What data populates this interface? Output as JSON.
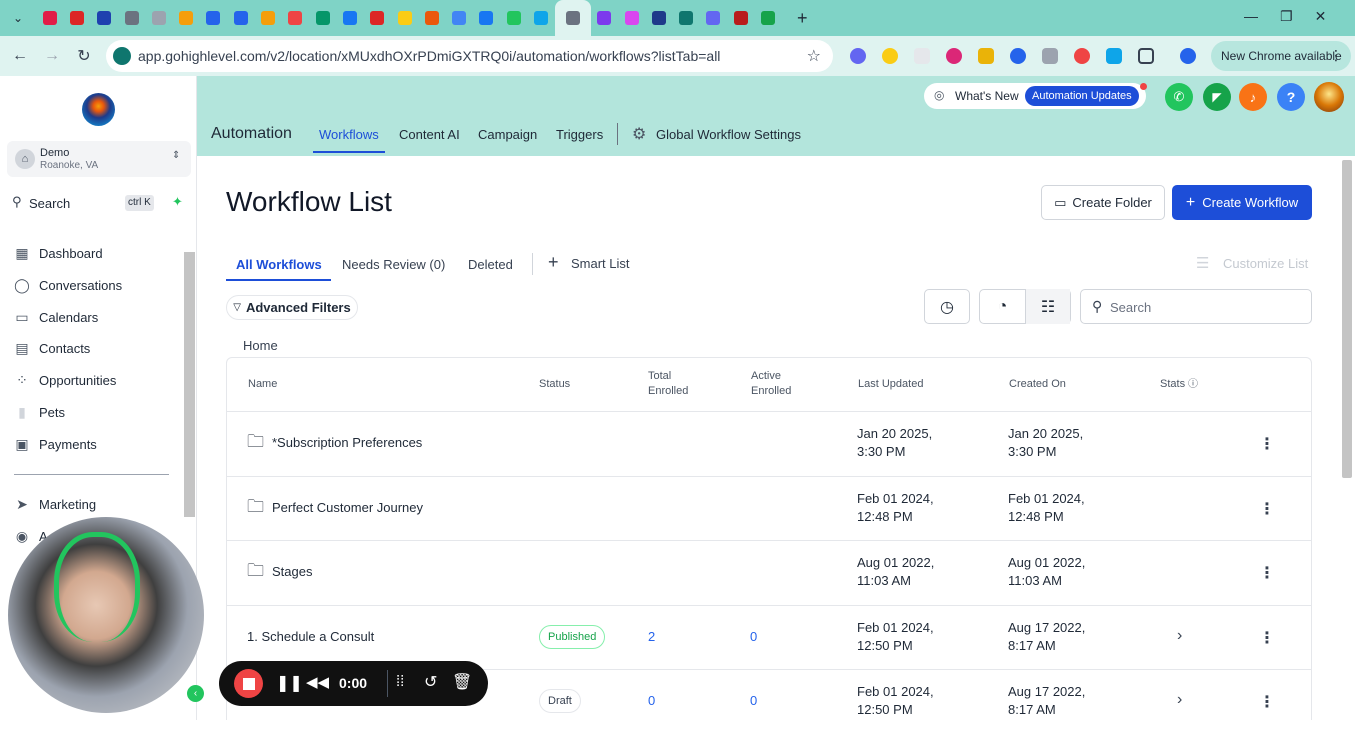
{
  "browser": {
    "url": "app.gohighlevel.com/v2/location/xMUxdhOXrPDmiGXTRQ0i/automation/workflows?listTab=all",
    "new_chrome": "New Chrome available",
    "tab_favicon_colors": [
      "#e11d48",
      "#dc2626",
      "#1e40af",
      "#6b7280",
      "#9ca3af",
      "#f59e0b",
      "#2563eb",
      "#2563eb",
      "#f59e0b",
      "#ef4444",
      "#059669",
      "#1877f2",
      "#dc2626",
      "#facc15",
      "#ea580c",
      "#4285f4",
      "#1877f2",
      "#22c55e",
      "#0ea5e9",
      "#6b7280",
      "#7c3aed",
      "#d946ef",
      "#1e3a8a",
      "#0f766e",
      "#6366f1",
      "#b91c1c",
      "#16a34a"
    ]
  },
  "account": {
    "name": "Demo",
    "location": "Roanoke, VA"
  },
  "search": {
    "label": "Search",
    "shortcut": "ctrl K"
  },
  "sidebar": {
    "items": [
      {
        "label": "Dashboard",
        "icon": "grid-icon"
      },
      {
        "label": "Conversations",
        "icon": "chat-icon"
      },
      {
        "label": "Calendars",
        "icon": "calendar-icon"
      },
      {
        "label": "Contacts",
        "icon": "contacts-icon"
      },
      {
        "label": "Opportunities",
        "icon": "opportunities-icon"
      },
      {
        "label": "Pets",
        "icon": "pets-icon"
      },
      {
        "label": "Payments",
        "icon": "payments-icon"
      },
      {
        "label": "Marketing",
        "icon": "marketing-icon"
      },
      {
        "label": "A",
        "icon": "automation-icon"
      }
    ]
  },
  "header": {
    "whats_new": "What's New",
    "automation_updates": "Automation Updates",
    "section": "Automation",
    "tabs": [
      "Workflows",
      "Content AI",
      "Campaign",
      "Triggers"
    ],
    "global_settings": "Global Workflow Settings"
  },
  "main": {
    "title": "Workflow List",
    "create_folder": "Create Folder",
    "create_workflow": "Create Workflow",
    "subtabs": [
      "All Workflows",
      "Needs Review (0)",
      "Deleted"
    ],
    "smart_list": "Smart List",
    "customize_list": "Customize List",
    "advanced_filters": "Advanced Filters",
    "search_placeholder": "Search",
    "breadcrumb": "Home"
  },
  "table": {
    "columns": {
      "name": "Name",
      "status": "Status",
      "total_enrolled_1": "Total",
      "total_enrolled_2": "Enrolled",
      "active_enrolled_1": "Active",
      "active_enrolled_2": "Enrolled",
      "last_updated": "Last Updated",
      "created_on": "Created On",
      "stats": "Stats"
    },
    "rows": [
      {
        "name": "*Subscription Preferences",
        "folder": true,
        "status": "",
        "total": "",
        "active": "",
        "updated_1": "Jan 20 2025,",
        "updated_2": "3:30 PM",
        "created_1": "Jan 20 2025,",
        "created_2": "3:30 PM"
      },
      {
        "name": "Perfect Customer Journey",
        "folder": true,
        "status": "",
        "total": "",
        "active": "",
        "updated_1": "Feb 01 2024,",
        "updated_2": "12:48 PM",
        "created_1": "Feb 01 2024,",
        "created_2": "12:48 PM"
      },
      {
        "name": "Stages",
        "folder": true,
        "status": "",
        "total": "",
        "active": "",
        "updated_1": "Aug 01 2022,",
        "updated_2": "11:03 AM",
        "created_1": "Aug 01 2022,",
        "created_2": "11:03 AM"
      },
      {
        "name": "1. Schedule a Consult",
        "folder": false,
        "status": "Published",
        "total": "2",
        "active": "0",
        "updated_1": "Feb 01 2024,",
        "updated_2": "12:50 PM",
        "created_1": "Aug 17 2022,",
        "created_2": "8:17 AM"
      },
      {
        "name": "",
        "folder": false,
        "status": "Draft",
        "total": "0",
        "active": "0",
        "updated_1": "Feb 01 2024,",
        "updated_2": "12:50 PM",
        "created_1": "Aug 17 2022,",
        "created_2": "8:17 AM"
      }
    ]
  },
  "recorder": {
    "time": "0:00"
  }
}
